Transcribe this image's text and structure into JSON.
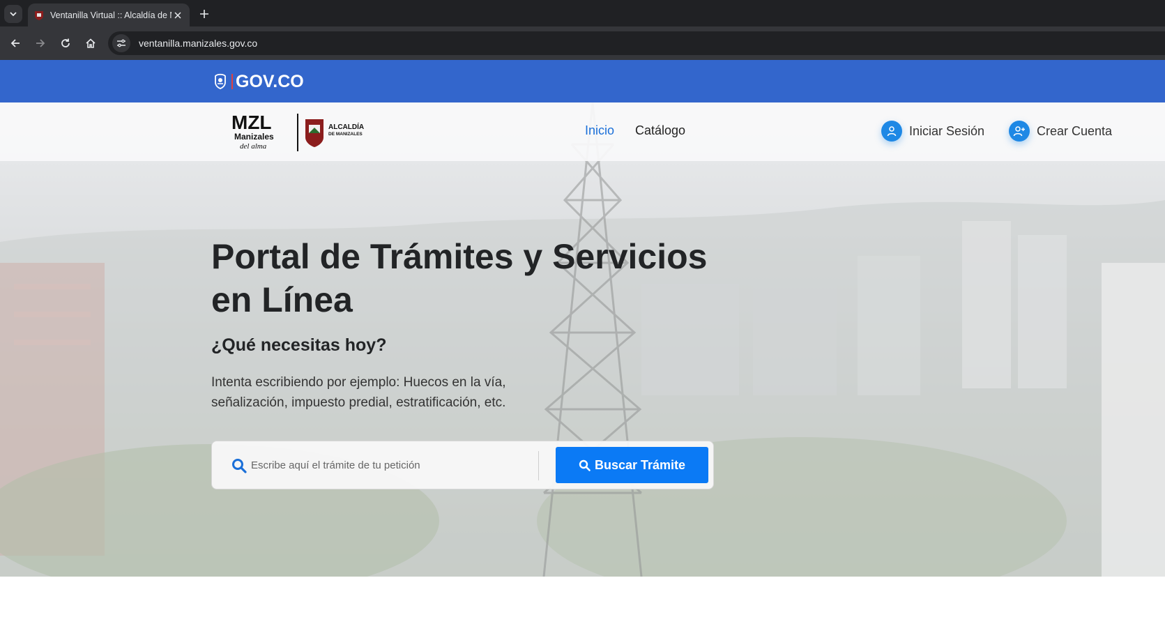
{
  "browser": {
    "tab_title": "Ventanilla Virtual :: Alcaldía de M",
    "url": "ventanilla.manizales.gov.co"
  },
  "govbar": {
    "logo_text": "GOV.CO"
  },
  "header": {
    "brand_mzl": "MZL",
    "brand_manizales": "Manizales",
    "brand_tagline": "del alma",
    "brand_alcaldia": "ALCALDÍA",
    "brand_de": "DE MANIZALES",
    "nav": [
      {
        "label": "Inicio",
        "active": true
      },
      {
        "label": "Catálogo",
        "active": false
      }
    ],
    "login_label": "Iniciar Sesión",
    "signup_label": "Crear Cuenta"
  },
  "hero": {
    "title": "Portal de Trámites y Servicios en Línea",
    "subtitle": "¿Qué necesitas hoy?",
    "description": "Intenta escribiendo por ejemplo: Huecos en la vía, señalización, impuesto predial, estratificación, etc.",
    "search_placeholder": "Escribe aquí el trámite de tu petición",
    "search_button": "Buscar Trámite"
  },
  "colors": {
    "gov_blue": "#3366cc",
    "primary_button": "#0b7af5",
    "nav_active": "#1a6fd8"
  }
}
